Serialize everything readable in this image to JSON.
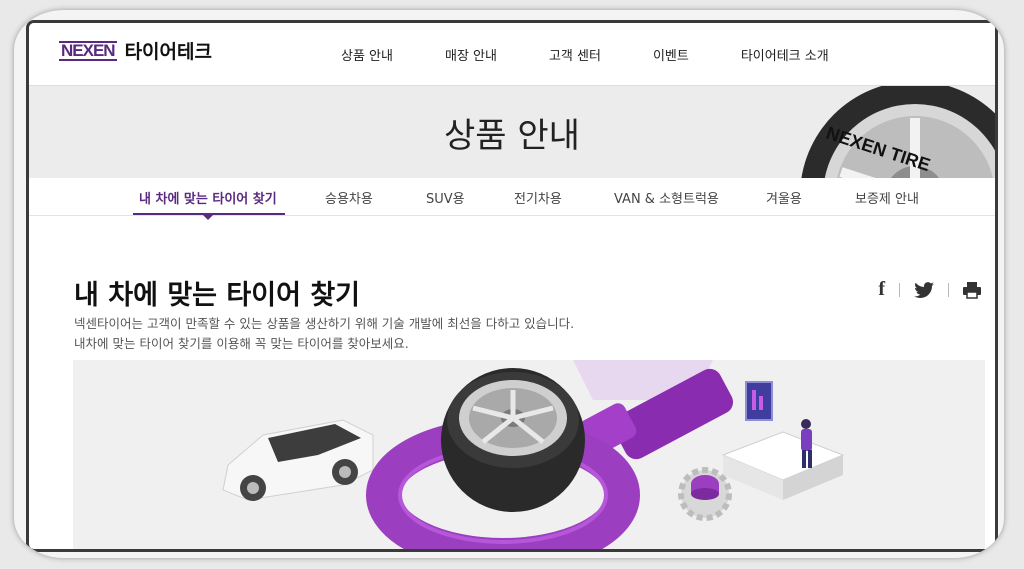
{
  "header": {
    "logo_mark": "NEXEN",
    "logo_text": "타이어테크",
    "nav": [
      "상품 안내",
      "매장 안내",
      "고객 센터",
      "이벤트",
      "타이어테크 소개"
    ]
  },
  "banner": {
    "title": "상품 안내",
    "tire_text": "NEXEN TIRE"
  },
  "subtabs": {
    "items": [
      "내 차에 맞는 타이어 찾기",
      "승용차용",
      "SUV용",
      "전기차용",
      "VAN & 소형트럭용",
      "겨울용",
      "보증제 안내"
    ],
    "active_index": 0
  },
  "content": {
    "heading": "내 차에 맞는 타이어 찾기",
    "desc_line1": "넥센타이어는 고객이 만족할 수 있는 상품을 생산하기 위해 기술 개발에 최선을 다하고 있습니다.",
    "desc_line2": "내차에 맞는 타이어 찾기를 이용해 꼭 맞는 타이어를 찾아보세요."
  },
  "share": {
    "icons": [
      "facebook-icon",
      "twitter-icon",
      "print-icon"
    ]
  },
  "colors": {
    "brand_purple": "#5a2a82",
    "accent_purple": "#9b3fc0"
  }
}
